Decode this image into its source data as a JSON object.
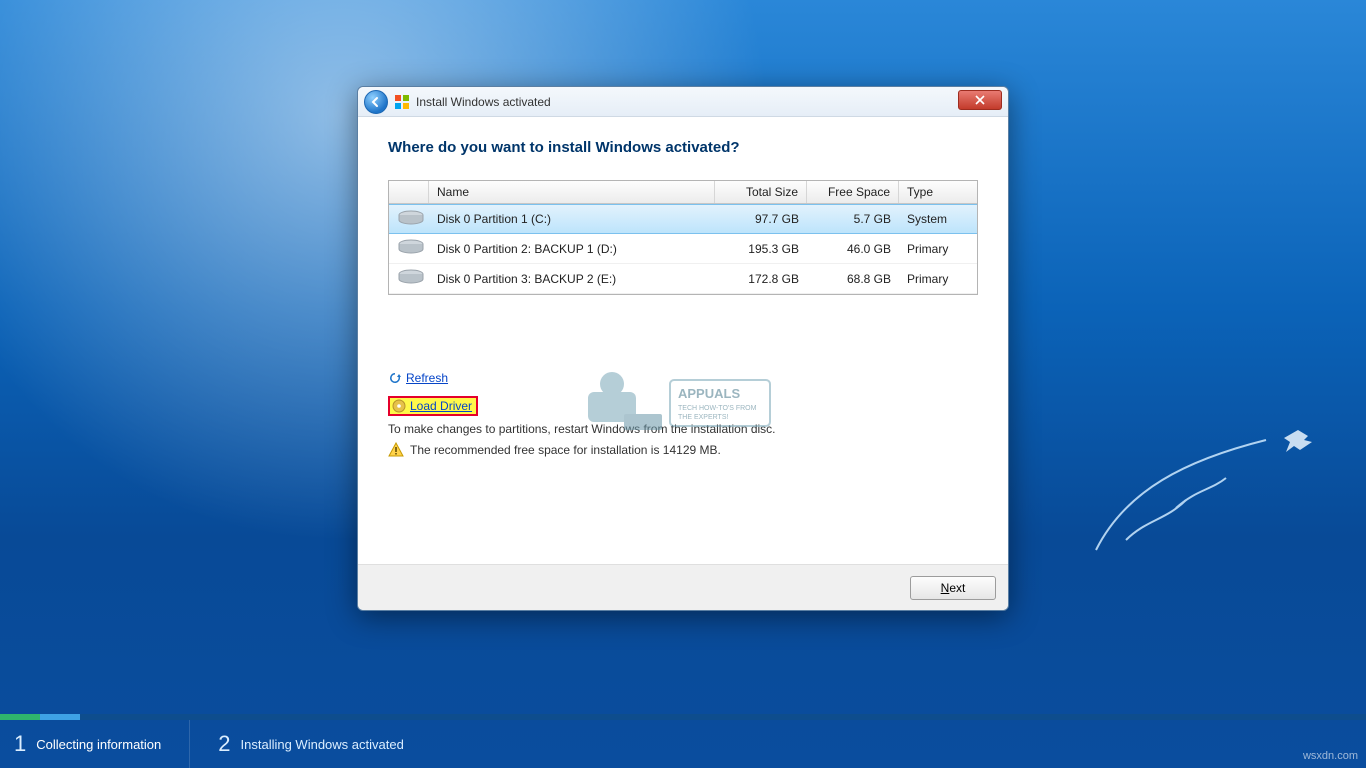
{
  "window": {
    "title": "Install Windows activated",
    "heading": "Where do you want to install Windows activated?",
    "columns": {
      "name": "Name",
      "total": "Total Size",
      "free": "Free Space",
      "type": "Type"
    },
    "partitions": [
      {
        "name": "Disk 0 Partition 1 (C:)",
        "total": "97.7 GB",
        "free": "5.7 GB",
        "type": "System",
        "selected": true
      },
      {
        "name": "Disk 0 Partition 2: BACKUP 1 (D:)",
        "total": "195.3 GB",
        "free": "46.0 GB",
        "type": "Primary",
        "selected": false
      },
      {
        "name": "Disk 0 Partition 3: BACKUP 2 (E:)",
        "total": "172.8 GB",
        "free": "68.8 GB",
        "type": "Primary",
        "selected": false
      }
    ],
    "refresh": "Refresh",
    "load_driver": "Load Driver",
    "restart_note": "To make changes to partitions, restart Windows from the installation disc.",
    "space_warning": "The recommended free space for installation is 14129 MB.",
    "next": "Next"
  },
  "steps": {
    "s1": {
      "num": "1",
      "label": "Collecting information"
    },
    "s2": {
      "num": "2",
      "label": "Installing Windows activated"
    }
  },
  "watermark": {
    "brand": "APPUALS",
    "tag1": "TECH HOW-TO'S FROM",
    "tag2": "THE EXPERTS!"
  },
  "source": "wsxdn.com"
}
